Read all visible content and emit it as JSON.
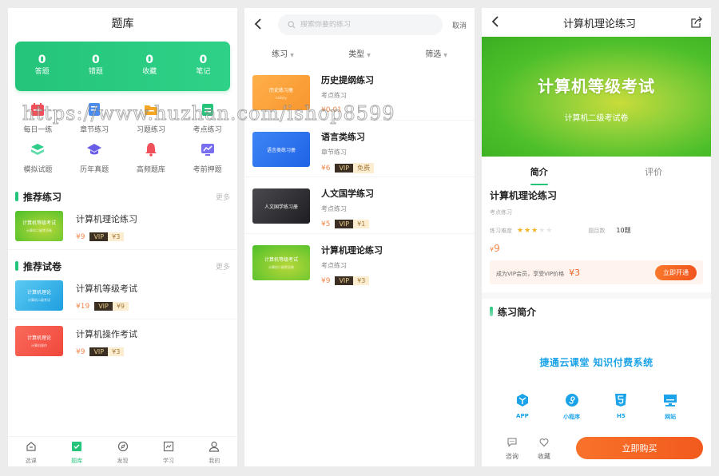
{
  "screen1": {
    "title": "题库",
    "stats": [
      {
        "value": "0",
        "label": "答题"
      },
      {
        "value": "0",
        "label": "错题"
      },
      {
        "value": "0",
        "label": "收藏"
      },
      {
        "value": "0",
        "label": "笔记"
      }
    ],
    "grid": [
      {
        "label": "每日一练",
        "icon": "calendar-icon",
        "color": "#f0505a"
      },
      {
        "label": "章节练习",
        "icon": "document-icon",
        "color": "#4a8cf0"
      },
      {
        "label": "习题练习",
        "icon": "folder-icon",
        "color": "#f5a623"
      },
      {
        "label": "考点练习",
        "icon": "clipboard-icon",
        "color": "#24c57a"
      },
      {
        "label": "模拟试题",
        "icon": "layers-icon",
        "color": "#2ecb8a"
      },
      {
        "label": "历年真题",
        "icon": "graduation-cap-icon",
        "color": "#6a5ee8"
      },
      {
        "label": "高频题库",
        "icon": "bell-icon",
        "color": "#f0505a"
      },
      {
        "label": "考前押题",
        "icon": "chart-monitor-icon",
        "color": "#7a6ef0"
      }
    ],
    "sections": [
      {
        "title": "推荐练习",
        "more": "更多",
        "items": [
          {
            "name": "计算机理论练习",
            "price": "¥9",
            "vip_label": "VIP",
            "vip_price": "¥3",
            "thumb_text": "计算机等级考试",
            "thumb_sub": "计算机二级考试卷"
          }
        ]
      },
      {
        "title": "推荐试卷",
        "more": "更多",
        "items": [
          {
            "name": "计算机等级考试",
            "price": "¥19",
            "vip_label": "VIP",
            "vip_price": "¥9",
            "thumb_text": "计算机理论",
            "thumb_sub": "计算机二级考试"
          },
          {
            "name": "计算机操作考试",
            "price": "¥9",
            "vip_label": "VIP",
            "vip_price": "¥3",
            "thumb_text": "计算机理论",
            "thumb_sub": "计算机操作"
          }
        ]
      }
    ],
    "tabbar": [
      {
        "label": "选课",
        "icon": "home-icon"
      },
      {
        "label": "题库",
        "icon": "checkbox-icon",
        "active": true
      },
      {
        "label": "发现",
        "icon": "compass-icon"
      },
      {
        "label": "学习",
        "icon": "chart-icon"
      },
      {
        "label": "我的",
        "icon": "user-icon"
      }
    ]
  },
  "screen2": {
    "search_placeholder": "搜索你要的练习",
    "search_value": "",
    "cancel": "取消",
    "filters": [
      "练习",
      "类型",
      "筛选"
    ],
    "items": [
      {
        "name": "历史提纲练习",
        "type": "考点练习",
        "price": "¥0.01",
        "vip_label": "",
        "vip_price": "",
        "thumb_text": "历史练习册",
        "thumb_sub": "history",
        "thumb_color": "orange"
      },
      {
        "name": "语言类练习",
        "type": "章节练习",
        "price": "¥6",
        "vip_label": "VIP",
        "vip_price": "免费",
        "thumb_text": "语言类练习册",
        "thumb_sub": "",
        "thumb_color": "blue"
      },
      {
        "name": "人文国学练习",
        "type": "考点练习",
        "price": "¥5",
        "vip_label": "VIP",
        "vip_price": "¥1",
        "thumb_text": "人文国学练习册",
        "thumb_sub": "",
        "thumb_color": "dark"
      },
      {
        "name": "计算机理论练习",
        "type": "考点练习",
        "price": "¥9",
        "vip_label": "VIP",
        "vip_price": "¥3",
        "thumb_text": "计算机等级考试",
        "thumb_sub": "计算机二级考试卷",
        "thumb_color": "green"
      }
    ]
  },
  "screen3": {
    "title": "计算机理论练习",
    "banner_title": "计算机等级考试",
    "banner_sub": "计算机二级考试卷",
    "tabs": [
      "简介",
      "评价"
    ],
    "name": "计算机理论练习",
    "type": "考点练习",
    "difficulty_label": "练习难度",
    "difficulty_stars": 3,
    "difficulty_max": 5,
    "question_label": "题目数",
    "question_value": "10题",
    "price_symbol": "¥",
    "price_value": "9",
    "vip_text": "成为VIP会员，享受VIP价格",
    "vip_price": "¥3",
    "vip_button": "立即开通",
    "intro_title": "练习简介",
    "promo_text": "捷通云课堂 知识付费系统",
    "platforms": [
      {
        "label": "APP",
        "icon": "cube-icon"
      },
      {
        "label": "小程序",
        "icon": "mini-program-icon"
      },
      {
        "label": "H5",
        "icon": "html5-icon"
      },
      {
        "label": "网站",
        "icon": "monitor-icon"
      }
    ],
    "consult": "咨询",
    "favorite": "收藏",
    "buy": "立即购买"
  },
  "watermark": "https://www.huzhan.com/ishop8599"
}
